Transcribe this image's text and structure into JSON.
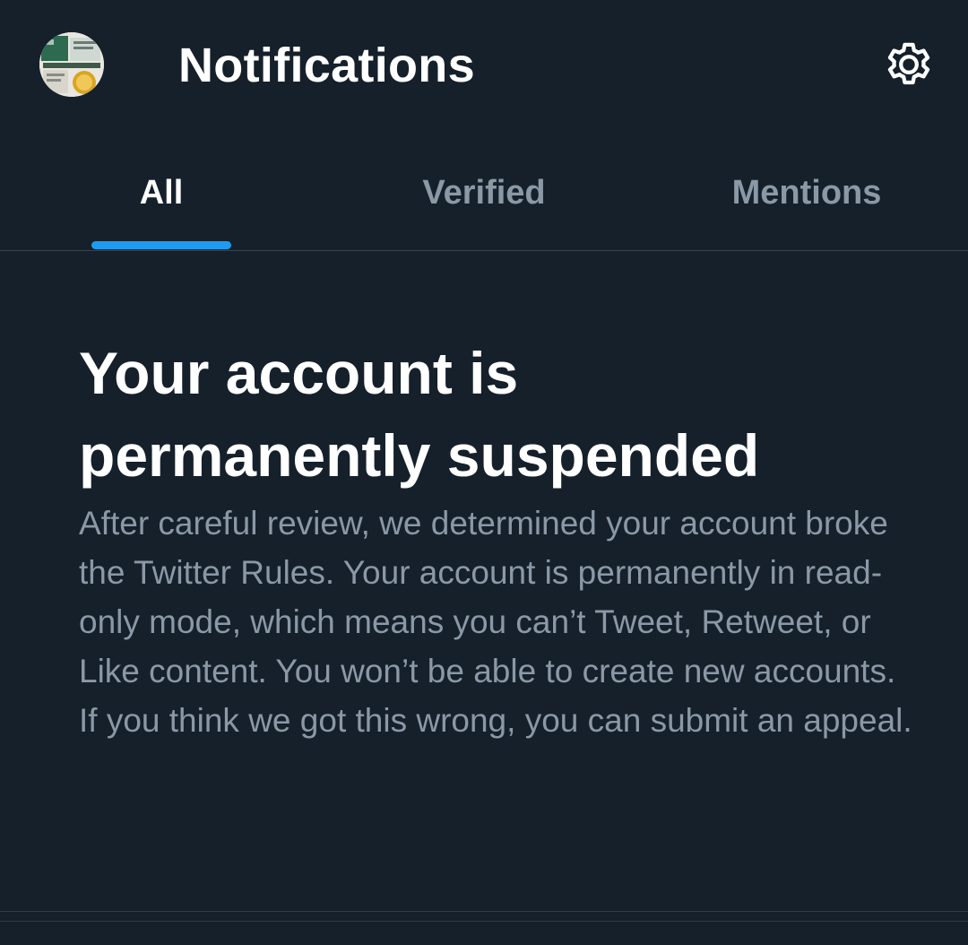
{
  "header": {
    "title": "Notifications",
    "avatar_icon": "profile-avatar",
    "settings_icon": "gear-icon"
  },
  "tabs": [
    {
      "label": "All",
      "active": true
    },
    {
      "label": "Verified",
      "active": false
    },
    {
      "label": "Mentions",
      "active": false
    }
  ],
  "notice": {
    "title": "Your account is permanently suspended",
    "body": "After careful review, we determined your account broke the Twitter Rules. Your account is permanently in read-only mode, which means you can’t Tweet, Retweet, or Like content. You won’t be able to create new accounts. If you think we got this wrong, you can submit an appeal."
  },
  "colors": {
    "background": "#15202b",
    "accent": "#1d9bf0",
    "muted_text": "#8b98a5",
    "divider": "#38444d"
  }
}
